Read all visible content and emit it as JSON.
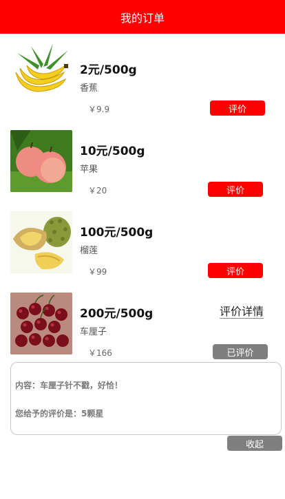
{
  "header": {
    "title": "我的订单"
  },
  "orders": [
    {
      "price": "2元/500g",
      "name": "香蕉",
      "amount": "￥9.9",
      "button": "评价",
      "image": "banana-image"
    },
    {
      "price": "10元/500g",
      "name": "苹果",
      "amount": "￥20",
      "button": "评价",
      "image": "apple-image"
    },
    {
      "price": "100元/500g",
      "name": "榴莲",
      "amount": "￥99",
      "button": "评价",
      "image": "durian-image"
    },
    {
      "price": "200元/500g",
      "name": "车厘子",
      "amount": "￥166",
      "button": "已评价",
      "detail_link": "评价详情",
      "image": "cherry-image"
    }
  ],
  "review": {
    "content": "内容：车厘子针不戳，好恰！",
    "rating": "您给予的评价是：5颗星",
    "collapse_button": "收起"
  },
  "colors": {
    "header_bg": "#ff0000",
    "button_red": "#ff0000",
    "button_gray": "#7f7f7f"
  }
}
